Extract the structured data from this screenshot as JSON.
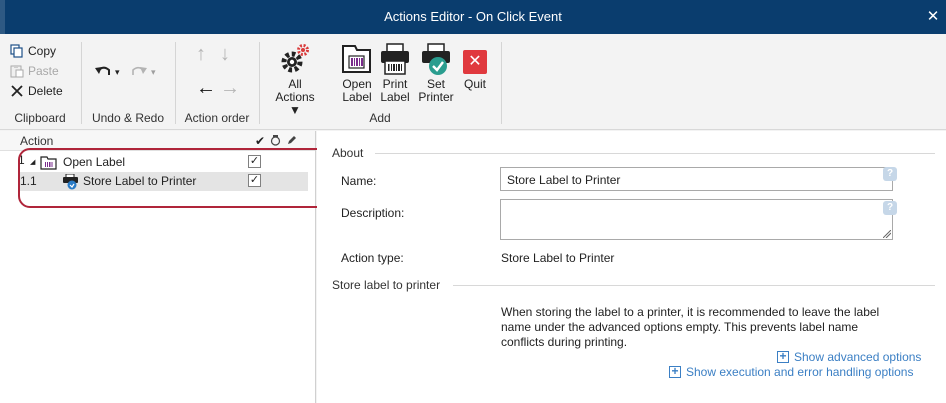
{
  "window": {
    "title": "Actions Editor - On Click Event",
    "close_glyph": "✕"
  },
  "ribbon": {
    "clipboard": {
      "copy": "Copy",
      "paste": "Paste",
      "delete": "Delete",
      "group_label": "Clipboard"
    },
    "undo_redo": {
      "group_label": "Undo & Redo"
    },
    "action_order": {
      "group_label": "Action order"
    },
    "add": {
      "all_actions": [
        "All",
        "Actions ▼"
      ],
      "open_label": [
        "Open",
        "Label"
      ],
      "print_label": [
        "Print",
        "Label"
      ],
      "set_printer": [
        "Set",
        "Printer"
      ],
      "quit": [
        "Quit"
      ],
      "group_label": "Add"
    }
  },
  "tree": {
    "header": "Action",
    "rows": [
      {
        "num": "1",
        "label": "Open Label",
        "checked": "✓"
      },
      {
        "num": "1.1",
        "label": "Store Label to Printer",
        "checked": "✓"
      }
    ]
  },
  "details": {
    "about_section": "About",
    "name_label": "Name:",
    "name_value": "Store Label to Printer",
    "description_label": "Description:",
    "description_value": "",
    "action_type_label": "Action type:",
    "action_type_value": "Store Label to Printer",
    "store_section": "Store label to printer",
    "info_lines": [
      "When storing the label to a printer, it is recommended to leave the label",
      "name under the advanced options empty. This prevents label name",
      "conflicts during printing."
    ],
    "show_advanced": "Show advanced options",
    "show_execution": "Show execution and error handling options"
  },
  "colors": {
    "titlebar": "#0a3d6e",
    "accent_link": "#3b7fc4",
    "highlight_ring": "#b0253a",
    "quit_red": "#e0393e",
    "gear_red": "#d93a3a"
  }
}
